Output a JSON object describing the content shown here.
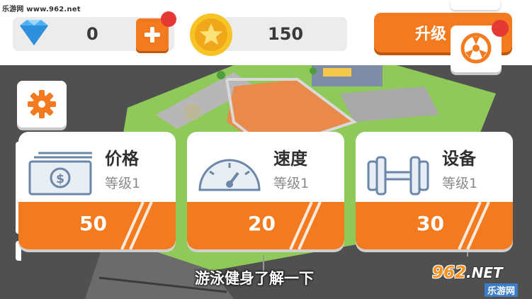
{
  "watermark": "乐游网 www.962.net",
  "resources": {
    "gems": "0",
    "coins": "150"
  },
  "header": {
    "upgrade_label": "升级"
  },
  "icons": {
    "gem": "diamond-icon",
    "coin": "star-coin-icon",
    "plus": "plus-icon",
    "settings": "gear-icon",
    "fan": "fan-icon",
    "notification": "red-dot-icon"
  },
  "cards": [
    {
      "title": "价格",
      "level": "等级1",
      "price": "50",
      "icon": "money-icon"
    },
    {
      "title": "速度",
      "level": "等级1",
      "price": "20",
      "icon": "speedometer-icon"
    },
    {
      "title": "设备",
      "level": "等级1",
      "price": "30",
      "icon": "dumbbell-icon"
    }
  ],
  "subtitle": "游泳健身了解一下",
  "logo": {
    "brand": "962",
    "suffix": ".NET",
    "tagline": "乐游网"
  },
  "colors": {
    "accent": "#f37a1e",
    "accent_dark": "#c2560a",
    "notification": "#e53935",
    "pill_bg": "#ececec",
    "text_dark": "#2f2f2f",
    "text_muted": "#8a8a8a"
  }
}
